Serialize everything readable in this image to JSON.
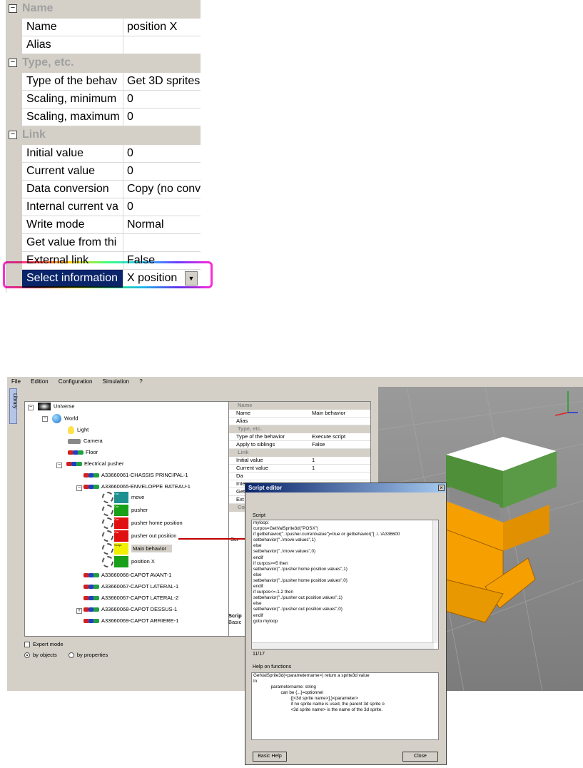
{
  "zoom_grid": {
    "sections": [
      {
        "label": "Name",
        "rows": [
          {
            "key": "Name",
            "value": "position X"
          },
          {
            "key": "Alias",
            "value": ""
          }
        ]
      },
      {
        "label": "Type, etc.",
        "rows": [
          {
            "key": "Type of the behav",
            "value": "Get 3D sprites"
          },
          {
            "key": "Scaling, minimum",
            "value": "0"
          },
          {
            "key": "Scaling, maximum",
            "value": "0"
          }
        ]
      },
      {
        "label": "Link",
        "rows": [
          {
            "key": "Initial value",
            "value": "0"
          },
          {
            "key": "Current value",
            "value": "0"
          },
          {
            "key": "Data conversion",
            "value": "Copy (no conv"
          },
          {
            "key": "Internal current va",
            "value": "0"
          },
          {
            "key": "Write mode",
            "value": "Normal"
          },
          {
            "key": "Get value from thi",
            "value": ""
          },
          {
            "key": "External link",
            "value": "False"
          },
          {
            "key": "Select information",
            "value": "X position"
          }
        ]
      }
    ]
  },
  "menu": [
    "File",
    "Edition",
    "Configuration",
    "Simulation",
    "?"
  ],
  "library_tab": "Library",
  "tree": {
    "universe": "Universe",
    "world": "World",
    "light": "Light",
    "camera": "Camera",
    "floor": "Floor",
    "pusher": "Electrical pusher",
    "parts": [
      "A33660061-CHASSIS PRINCIPAL-1",
      "A33660065-ENVELOPPE RATEAU-1",
      "A33660066-CAPOT AVANT-1",
      "A33660067-CAPOT LATERAL-1",
      "A33660067-CAPOT LATERAL-2",
      "A33660068-CAPOT DESSUS-1",
      "A33660069-CAPOT ARRIERE-1"
    ],
    "behaviors": [
      "move",
      "pusher",
      "pusher home position",
      "pusher out position",
      "Main behavior",
      "position X"
    ],
    "swatch_labels": [
      "Cur",
      "Cur",
      "Cur",
      "Cur",
      "Script",
      ""
    ]
  },
  "options": {
    "expert": "Expert mode",
    "by_objects": "by objects",
    "by_properties": "by properties"
  },
  "small_grid": {
    "sec_name": "Name",
    "name_k": "Name",
    "name_v": "Main behavior",
    "alias_k": "Alias",
    "sec_type": "Type, etc.",
    "type_k": "Type of the behavior",
    "type_v": "Execute script",
    "apply_k": "Apply to siblings",
    "apply_v": "False",
    "sec_link": "Link",
    "init_k": "Initial value",
    "init_v": "1",
    "cur_k": "Current value",
    "cur_v": "1",
    "r3": "Da",
    "r4": "Inte",
    "r5": "Get",
    "r6": "Ext",
    "sec_co": "Co",
    "scr": "Scr",
    "scrip": "Scrip",
    "basic": "Basic"
  },
  "script_editor": {
    "title": "Script editor",
    "close_x": "×",
    "script_label": "Script",
    "code": [
      "myloop:",
      "curpos=GetValSprite3d(\"POSX\")",
      "if getbehavior(\"..\\pusher.currentvalue\")=true or getbehavior(\"[..\\..\\A336600",
      "setbehavior(\"..\\move.values\",1)",
      "else",
      "setbehavior(\"..\\move.values\",0)",
      "endif",
      "if curpos>=5 then",
      "setbehavior(\"..\\pusher home position.values\",1)",
      "else",
      "setbehavior(\"..\\pusher home position.values\",0)",
      "endif",
      "if curpos<=-1.2 then",
      "setbehavior(\"..\\pusher out position.values\",1)",
      "else",
      "setbehavior(\"..\\pusher out position.values\",0)",
      "endif",
      "goto myloop"
    ],
    "line_count": "11/17",
    "help_label": "Help on functions",
    "help": [
      "GetValSprite3d(<parametername>) return a sprite3d value",
      "In",
      "              parametername: string",
      "                      can be {...}=optionnel",
      "                              {[<3d sprite name>],}<parameter>",
      "                              if no sprite name is used, the parent 3d sprite o",
      "                              <3d sprite name> is the name of the 3d sprite."
    ],
    "basic_help": "Basic Help",
    "close": "Close"
  },
  "colors": {
    "selection": "#0a246a",
    "arrow": "#c00000",
    "box_orange": "#f5a000",
    "box_green": "#4f8f3a"
  }
}
